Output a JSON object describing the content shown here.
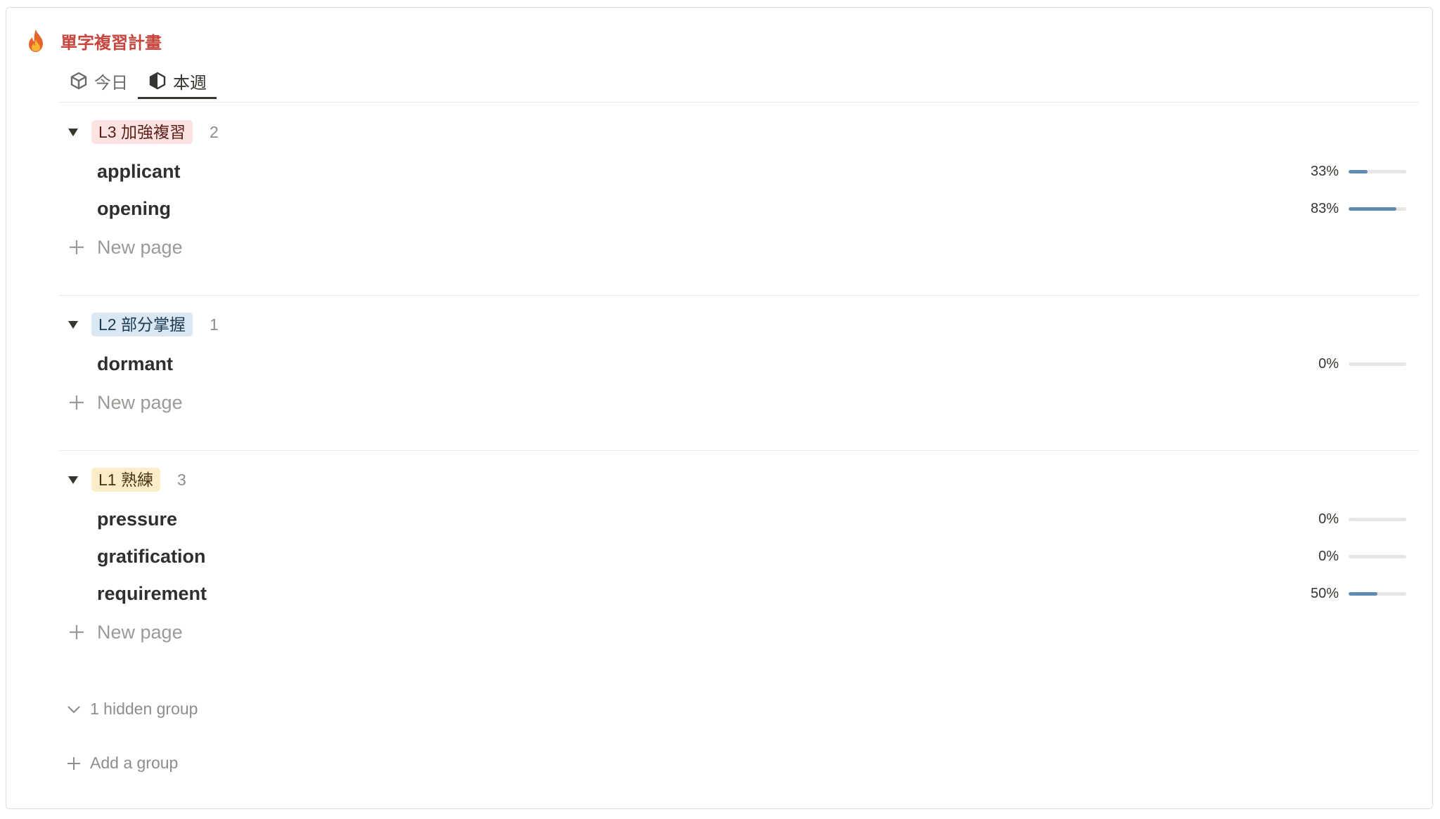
{
  "database": {
    "title": "單字複習計畫"
  },
  "tabs": [
    {
      "label": "今日",
      "active": false
    },
    {
      "label": "本週",
      "active": true
    }
  ],
  "groups": [
    {
      "tag": "L3 加強複習",
      "tag_color": "#fbe3e1",
      "count": "2",
      "items": [
        {
          "word": "applicant",
          "percent": "33%",
          "progress": 0.33
        },
        {
          "word": "opening",
          "percent": "83%",
          "progress": 0.83
        }
      ],
      "new_page_label": "New page"
    },
    {
      "tag": "L2 部分掌握",
      "tag_color": "#d9e8f3",
      "count": "1",
      "items": [
        {
          "word": "dormant",
          "percent": "0%",
          "progress": 0
        }
      ],
      "new_page_label": "New page"
    },
    {
      "tag": "L1 熟練",
      "tag_color": "#fbedc8",
      "count": "3",
      "items": [
        {
          "word": "pressure",
          "percent": "0%",
          "progress": 0
        },
        {
          "word": "gratification",
          "percent": "0%",
          "progress": 0
        },
        {
          "word": "requirement",
          "percent": "50%",
          "progress": 0.5
        }
      ],
      "new_page_label": "New page"
    }
  ],
  "footer": {
    "hidden_groups_label": "1 hidden group",
    "add_group_label": "Add a group"
  },
  "colors": {
    "accent_title": "#c6463d",
    "progress_fill": "#5f8bb3",
    "progress_track": "#e6e6e6"
  },
  "icons": {
    "title": "fire-icon",
    "tab_today": "cube-outline-icon",
    "tab_week": "cube-half-icon",
    "toggle": "triangle-down-icon",
    "add": "plus-icon",
    "hidden": "chevron-down-icon"
  }
}
